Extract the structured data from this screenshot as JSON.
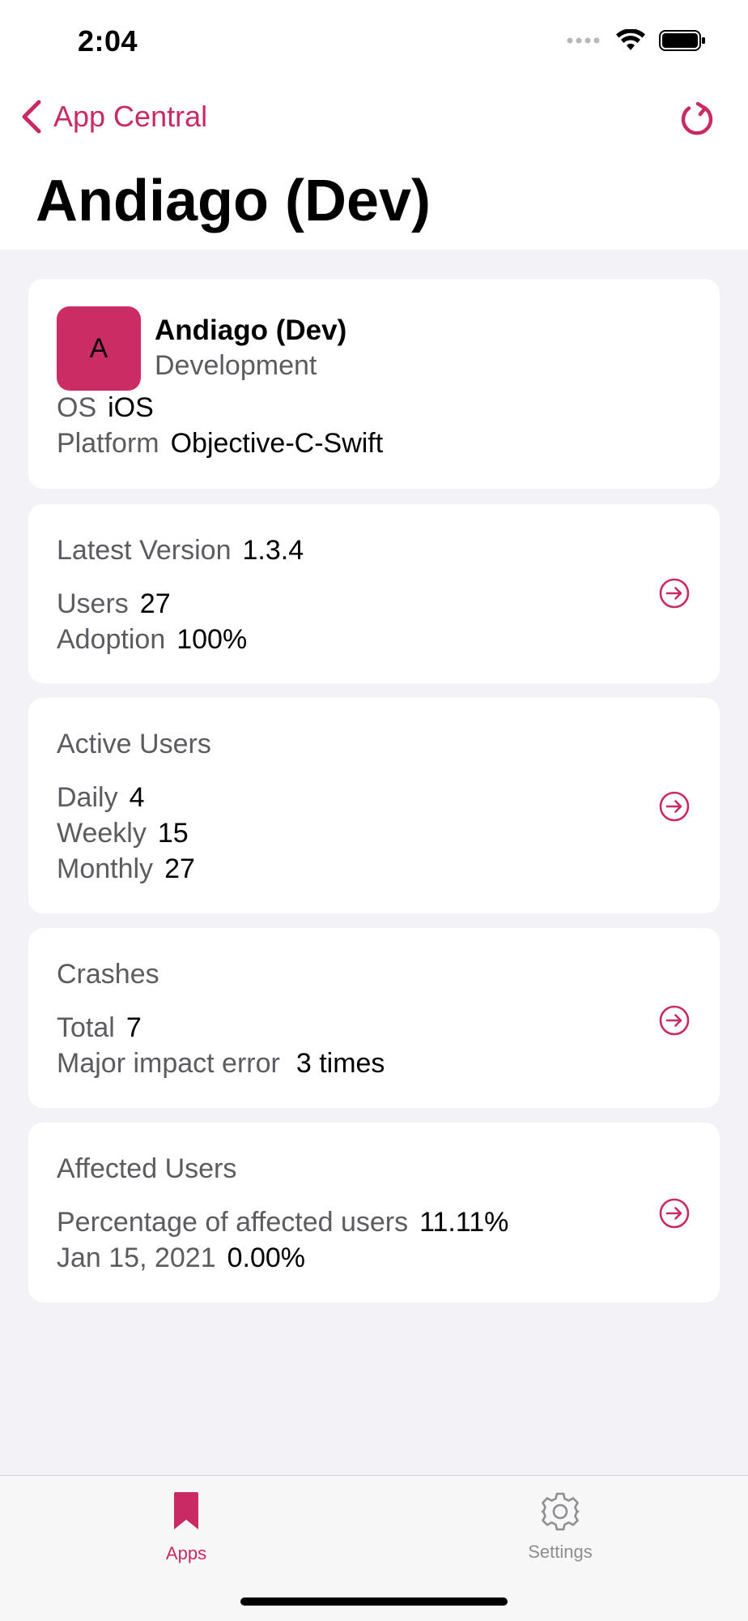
{
  "status_bar": {
    "time": "2:04"
  },
  "nav": {
    "back_label": "App Central",
    "title": "Andiago (Dev)"
  },
  "app_card": {
    "icon_letter": "A",
    "name": "Andiago (Dev)",
    "type": "Development",
    "os_label": "OS",
    "os_value": "iOS",
    "platform_label": "Platform",
    "platform_value": "Objective-C-Swift"
  },
  "version_card": {
    "latest_label": "Latest Version",
    "latest_value": "1.3.4",
    "users_label": "Users",
    "users_value": "27",
    "adoption_label": "Adoption",
    "adoption_value": "100%"
  },
  "active_users_card": {
    "title": "Active Users",
    "daily_label": "Daily",
    "daily_value": "4",
    "weekly_label": "Weekly",
    "weekly_value": "15",
    "monthly_label": "Monthly",
    "monthly_value": "27"
  },
  "crashes_card": {
    "title": "Crashes",
    "total_label": "Total",
    "total_value": "7",
    "major_label": "Major impact error",
    "major_value": "3 times"
  },
  "affected_card": {
    "title": "Affected Users",
    "percentage_label": "Percentage of affected users",
    "percentage_value": "11.11%",
    "date_label": "Jan 15, 2021",
    "date_value": "0.00%"
  },
  "tabbar": {
    "apps_label": "Apps",
    "settings_label": "Settings"
  },
  "colors": {
    "accent": "#c92a64",
    "background": "#f2f2f7",
    "card": "#ffffff"
  }
}
